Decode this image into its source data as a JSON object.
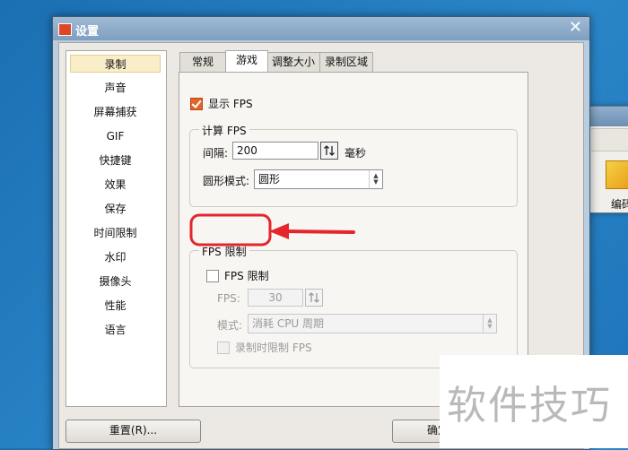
{
  "dialog": {
    "title": "设置",
    "close_glyph": "✕"
  },
  "background_window": {
    "label": "编码"
  },
  "sidebar": {
    "items": [
      {
        "label": "录制",
        "active": true
      },
      {
        "label": "声音"
      },
      {
        "label": "屏幕捕获"
      },
      {
        "label": "GIF"
      },
      {
        "label": "快捷键"
      },
      {
        "label": "效果"
      },
      {
        "label": "保存"
      },
      {
        "label": "时间限制"
      },
      {
        "label": "水印"
      },
      {
        "label": "摄像头"
      },
      {
        "label": "性能"
      },
      {
        "label": "语言"
      }
    ]
  },
  "tabs": [
    {
      "label": "常规"
    },
    {
      "label": "游戏",
      "active": true
    },
    {
      "label": "调整大小"
    },
    {
      "label": "录制区域"
    }
  ],
  "game": {
    "show_fps": {
      "label": "显示 FPS",
      "checked": true
    },
    "calc_group": {
      "title": "计算 FPS",
      "interval_label": "间隔:",
      "interval_value": "200",
      "interval_unit": "毫秒",
      "mode_label": "圆形模式:",
      "mode_value": "圆形"
    },
    "limit_group": {
      "title": "FPS 限制",
      "limit_checkbox": {
        "label": "FPS 限制",
        "checked": false
      },
      "fps_label": "FPS:",
      "fps_value": "30",
      "mode_label": "模式:",
      "mode_value": "消耗 CPU 周期",
      "record_limit": {
        "label": "录制时限制 FPS",
        "checked": false
      }
    }
  },
  "footer": {
    "reset_label": "重置(R)...",
    "ok_label": "确定"
  },
  "watermark": {
    "text": "软件技巧"
  },
  "colors": {
    "accent_checkbox": "#e0662a",
    "annotation_red": "#e3262c"
  }
}
